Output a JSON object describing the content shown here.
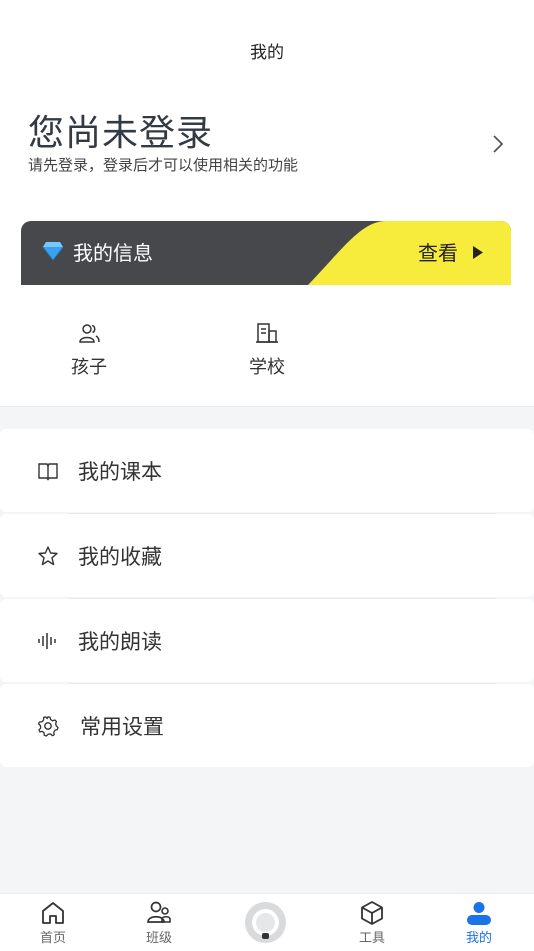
{
  "header": {
    "title": "我的"
  },
  "login": {
    "title": "您尚未登录",
    "subtitle": "请先登录，登录后才可以使用相关的功能"
  },
  "info_card": {
    "label": "我的信息",
    "action": "查看",
    "accent": "#f7ec3b",
    "dark": "#47484c"
  },
  "quick_links": [
    {
      "label": "孩子",
      "icon": "children-icon"
    },
    {
      "label": "学校",
      "icon": "school-icon"
    }
  ],
  "menu": [
    {
      "label": "我的课本",
      "icon": "book-icon"
    },
    {
      "label": "我的收藏",
      "icon": "star-icon"
    },
    {
      "label": "我的朗读",
      "icon": "audio-wave-icon"
    },
    {
      "label": "常用设置",
      "icon": "settings-gear-icon"
    }
  ],
  "tabbar": {
    "items": [
      {
        "label": "首页",
        "icon": "home-icon"
      },
      {
        "label": "班级",
        "icon": "class-icon"
      },
      {
        "label": "",
        "icon": "center-record-icon"
      },
      {
        "label": "工具",
        "icon": "tools-cube-icon"
      },
      {
        "label": "我的",
        "icon": "user-icon",
        "active": true
      }
    ],
    "active_color": "#1a73e8"
  }
}
